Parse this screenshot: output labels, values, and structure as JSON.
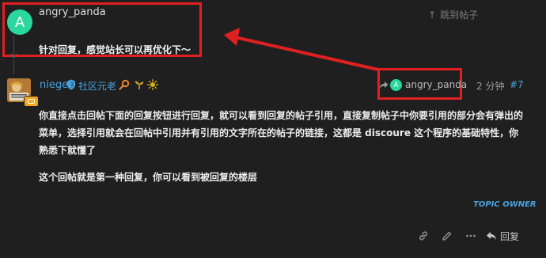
{
  "replied_post": {
    "avatar_letter": "A",
    "username": "angry_panda",
    "text": "针对回复，感觉站长可以再优化下～",
    "jump_label": "跳到帖子",
    "avatar_color": "#2ad79d"
  },
  "post": {
    "username": "niege",
    "group": "社区元老",
    "reply_to": {
      "avatar_letter": "A",
      "username": "angry_panda"
    },
    "time": "2 分钟",
    "post_number": "#7",
    "paragraphs": [
      "你直接点击回帖下面的回复按钮进行回复，就可以看到回复的帖子引用，直接复制帖子中你要引用的部分会有弹出的菜单，选择引用就会在回帖中引用并有引用的文字所在的帖子的链接，这都是 discoure 这个程序的基础特性，你熟悉下就懂了",
      "这个回帖就是第一种回复，你可以看到被回复的楼层"
    ],
    "topic_owner_label": "TOPIC OWNER",
    "reply_label": "回复",
    "badges": [
      "magnifier-icon",
      "sprout-icon",
      "sun-icon"
    ]
  },
  "colors": {
    "background": "#1f1f1f",
    "link": "#46a3e0",
    "highlight_border": "#e02020"
  }
}
